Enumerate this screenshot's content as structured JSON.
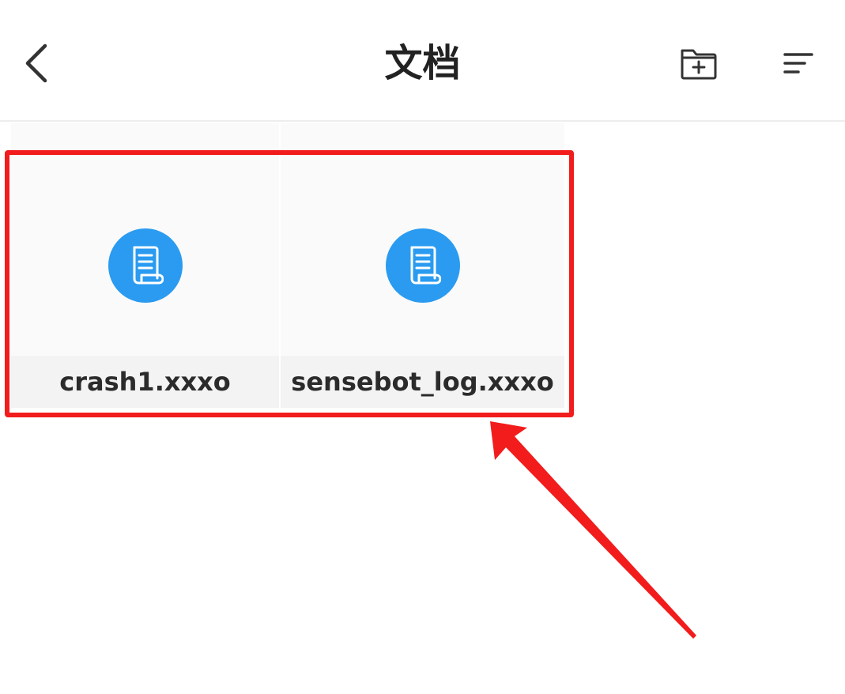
{
  "header": {
    "title": "文档",
    "back_icon": "chevron-left-icon",
    "new_folder_icon": "folder-plus-icon",
    "sort_icon": "sort-lines-icon"
  },
  "files": [
    {
      "name": "crash1.xxxo",
      "icon": "document-scroll-icon"
    },
    {
      "name": "sensebot_log.xxxo",
      "icon": "document-scroll-icon"
    }
  ],
  "colors": {
    "file_icon_bg": "#2a9bf0",
    "annotation": "#f21c1c",
    "title_text": "#222222"
  }
}
